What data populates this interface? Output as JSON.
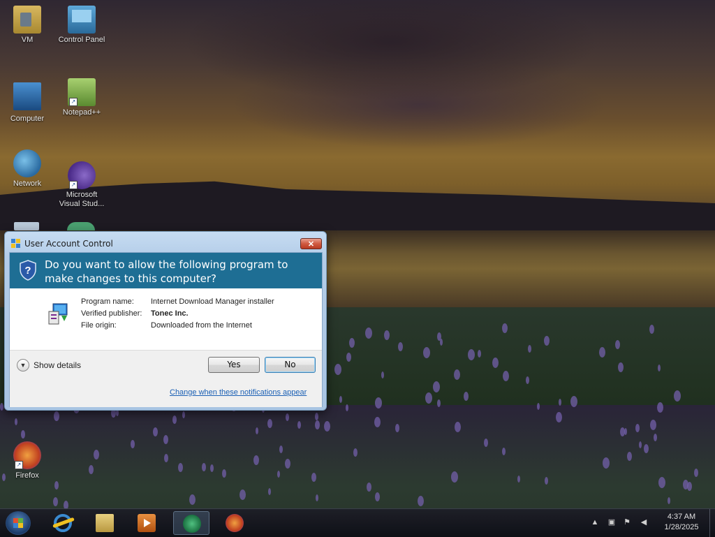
{
  "desktop": {
    "icons": [
      {
        "label": "VM",
        "icon": "folder-icon"
      },
      {
        "label": "Control Panel",
        "icon": "control-panel-icon"
      },
      {
        "label": "Computer",
        "icon": "computer-icon"
      },
      {
        "label": "Notepad++",
        "icon": "notepad-plus-plus-icon"
      },
      {
        "label": "Network",
        "icon": "network-icon"
      },
      {
        "label": "Microsoft Visual Stud...",
        "icon": "visual-studio-icon"
      },
      {
        "label": "Firefox",
        "icon": "firefox-icon"
      }
    ]
  },
  "uac": {
    "title": "User Account Control",
    "close_glyph": "✕",
    "question": "Do you want to allow the following program to make changes to this computer?",
    "program_name_label": "Program name:",
    "program_name_value": "Internet Download Manager installer",
    "publisher_label": "Verified publisher:",
    "publisher_value": "Tonec Inc.",
    "origin_label": "File origin:",
    "origin_value": "Downloaded from the Internet",
    "show_details": "Show details",
    "yes_label": "Yes",
    "no_label": "No",
    "notifications_link": "Change when these notifications appear",
    "colors": {
      "header": "#1e6e94",
      "link": "#1a5fb4"
    }
  },
  "taskbar": {
    "pinned": [
      {
        "name": "internet-explorer",
        "icon": "internet-explorer-icon"
      },
      {
        "name": "windows-explorer",
        "icon": "folder-icon"
      },
      {
        "name": "media-player",
        "icon": "media-player-icon"
      },
      {
        "name": "uac-prompt",
        "icon": "uac-consent-icon",
        "active": true
      },
      {
        "name": "firefox",
        "icon": "firefox-icon"
      }
    ],
    "tray": [
      "chevron-up-icon",
      "network-icon",
      "action-center-flag-icon",
      "volume-icon"
    ],
    "time": "4:37 AM",
    "date": "1/28/2025"
  }
}
